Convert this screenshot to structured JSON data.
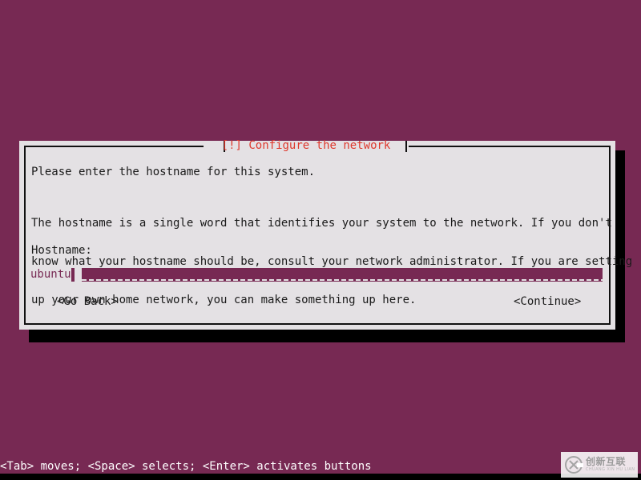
{
  "screen": {
    "background_color": "#772953",
    "dialog_bg_color": "#e4e1e4",
    "title_color": "#df382c",
    "text_color": "#1a1a1a"
  },
  "dialog": {
    "title": "[!] Configure the network",
    "paragraphs": [
      "Please enter the hostname for this system.",
      "The hostname is a single word that identifies your system to the network. If you don't\nknow what your hostname should be, consult your network administrator. If you are setting\nup your own home network, you can make something up here."
    ],
    "intro_line": "Please enter the hostname for this system.",
    "body_lines": [
      "The hostname is a single word that identifies your system to the network. If you don't",
      "know what your hostname should be, consult your network administrator. If you are setting",
      "up your own home network, you can make something up here."
    ],
    "field_label": "Hostname:",
    "hostname_input": {
      "value": "ubuntu",
      "placeholder": "",
      "selected": true,
      "field_color": "#772953",
      "text_color": "#772953",
      "highlight_color": "#e4e1e4"
    },
    "buttons": {
      "go_back": "<Go Back>",
      "continue": "<Continue>"
    }
  },
  "statusbar": {
    "hint": "<Tab> moves; <Space> selects; <Enter> activates buttons"
  },
  "watermark": {
    "logo_icon": "circle-x-logo-icon",
    "chinese": "创新互联",
    "pinyin": "CHUANG XIN HU LIAN"
  }
}
